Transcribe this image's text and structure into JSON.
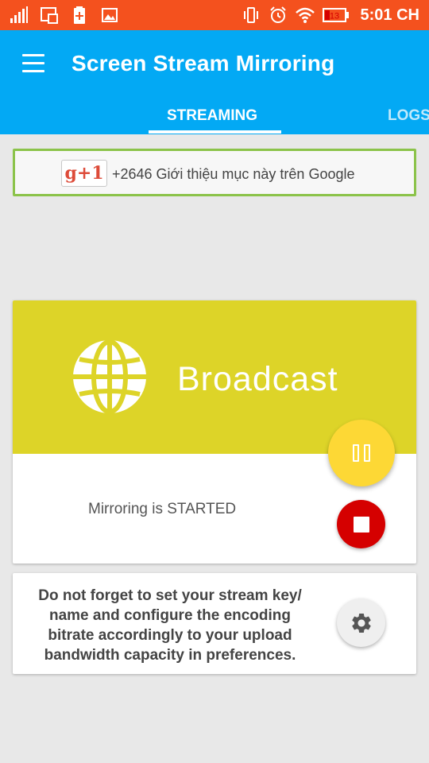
{
  "status_bar": {
    "time": "5:01 CH",
    "battery_level": "13",
    "icons_left": [
      "signal-icon",
      "screenshot-icon",
      "battery-plus-icon",
      "image-icon"
    ],
    "icons_right": [
      "vibrate-icon",
      "alarm-icon",
      "wifi-icon",
      "battery-icon"
    ]
  },
  "app_bar": {
    "title": "Screen Stream Mirroring",
    "tabs": [
      {
        "label": "STREAMING",
        "active": true
      },
      {
        "label": "LOGS",
        "active": false
      }
    ]
  },
  "plusone": {
    "badge": "g+1",
    "text": "+2646 Giới thiệu mục này trên Google"
  },
  "broadcast_card": {
    "title": "Broadcast",
    "status": "Mirroring is STARTED",
    "header_color": "#ddd428"
  },
  "controls": {
    "pause_icon": "pause-icon",
    "stop_icon": "stop-icon",
    "pause_color": "#fdd835",
    "stop_color": "#d50000"
  },
  "info_card": {
    "text": "Do not forget to set your stream key/ name and configure the encoding bitrate accordingly to your upload bandwidth capacity in preferences.",
    "settings_icon": "gear-icon"
  },
  "colors": {
    "status_bar": "#f4511e",
    "app_bar": "#03a9f4",
    "plusone_border": "#8bc34a"
  }
}
